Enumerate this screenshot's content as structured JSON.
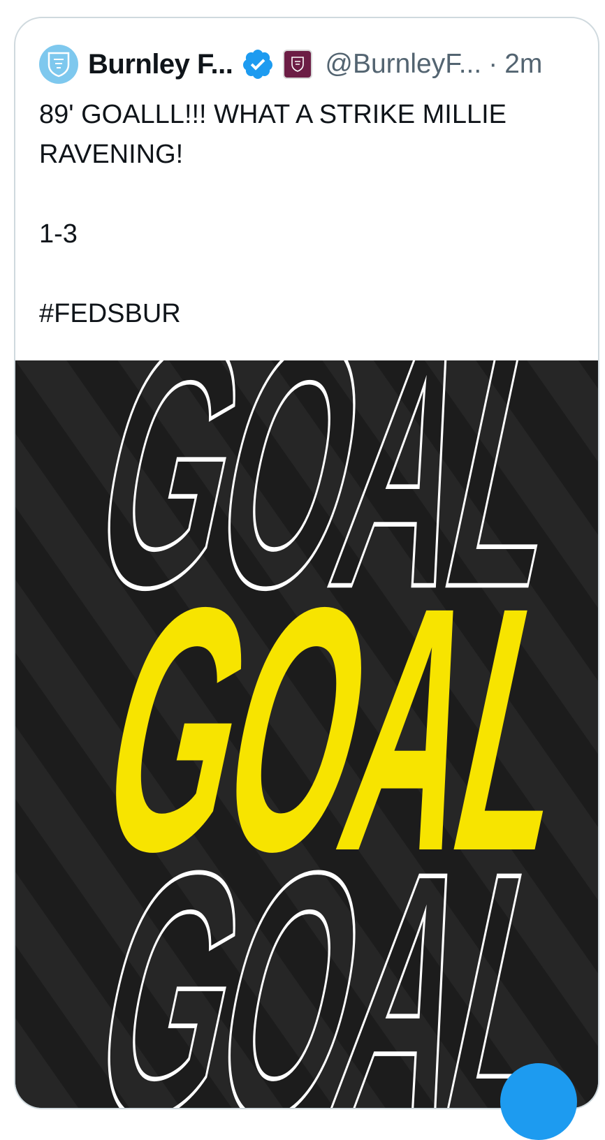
{
  "tweet": {
    "display_name": "Burnley F...",
    "handle": "@BurnleyF...",
    "separator": "·",
    "time": "2m",
    "lines": [
      "89' GOALLL!!! WHAT A STRIKE MILLIE RAVENING!",
      "",
      "1-3",
      "",
      "#FEDSBUR"
    ]
  },
  "media": {
    "words": [
      "GOAL",
      "GOAL",
      "GOAL"
    ],
    "colors": {
      "background": "#1c1c1c",
      "outline": "#ffffff",
      "highlight": "#f7e400"
    }
  },
  "icons": {
    "avatar": "club-crest-icon",
    "verified": "verified-badge-icon",
    "affiliation": "club-crest-affiliate-icon",
    "fab": "compose-button"
  },
  "colors": {
    "text": "#0f1419",
    "secondary": "#536471",
    "verified": "#1d9bf0",
    "border": "#cfd9de"
  }
}
